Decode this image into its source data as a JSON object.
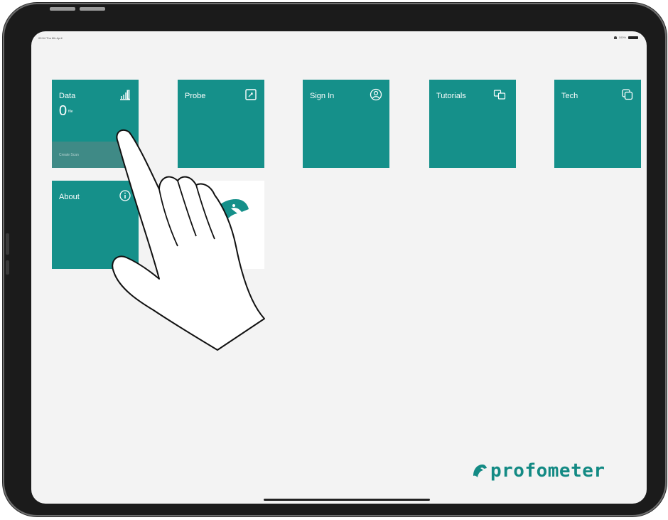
{
  "status_bar": {
    "time_date": "09:54 Thu 8th April",
    "battery": "100%"
  },
  "tiles": [
    {
      "label": "Data",
      "value": "0",
      "unit": "file",
      "footer": "Create Scan",
      "icon": "bar-chart-icon"
    },
    {
      "label": "Probe",
      "icon": "probe-icon"
    },
    {
      "label": "Sign In",
      "icon": "account-icon"
    },
    {
      "label": "Tutorials",
      "icon": "tutorials-icon"
    },
    {
      "label": "Tech",
      "icon": "tech-copy-icon"
    },
    {
      "label": "About",
      "icon": "info-icon"
    }
  ],
  "brand": {
    "name": "profometer"
  },
  "colors": {
    "tile": "#15908a",
    "tile_footer": "#3f8a86",
    "screen": "#f3f3f3",
    "brand": "#138a84"
  }
}
